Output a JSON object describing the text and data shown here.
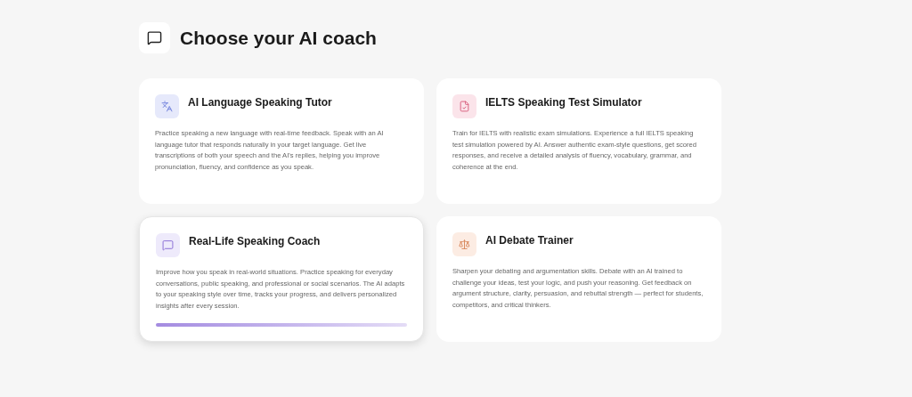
{
  "title": "Choose your AI coach",
  "coaches": [
    {
      "kind": "language",
      "color": "#e6e9fb",
      "name": "AI Language Speaking Tutor",
      "description": "Practice speaking a new language with real-time feedback. Speak with an AI language tutor that responds naturally in your target language. Get live transcriptions of both your speech and the AI's replies, helping you improve pronunciation, fluency, and confidence as you speak.",
      "selected": false
    },
    {
      "kind": "exam",
      "color": "#fbe4ea",
      "name": "IELTS Speaking Test Simulator",
      "description": "Train for IELTS with realistic exam simulations. Experience a full IELTS speaking test simulation powered by AI. Answer authentic exam-style questions, get scored responses, and receive a detailed analysis of fluency, vocabulary, grammar, and coherence at the end.",
      "selected": false
    },
    {
      "kind": "chat",
      "color": "#eeeafb",
      "name": "Real-Life Speaking Coach",
      "description": "Improve how you speak in real-world situations. Practice speaking for everyday conversations, public speaking, and professional or social scenarios. The AI adapts to your speaking style over time, tracks your progress, and delivers personalized insights after every session.",
      "selected": true
    },
    {
      "kind": "debate",
      "color": "#fcece3",
      "name": "AI Debate Trainer",
      "description": "Sharpen your debating and argumentation skills. Debate with an AI trained to challenge your ideas, test your logic, and push your reasoning. Get feedback on argument structure, clarity, persuasion, and rebuttal strength — perfect for students, competitors, and critical thinkers.",
      "selected": false
    }
  ]
}
